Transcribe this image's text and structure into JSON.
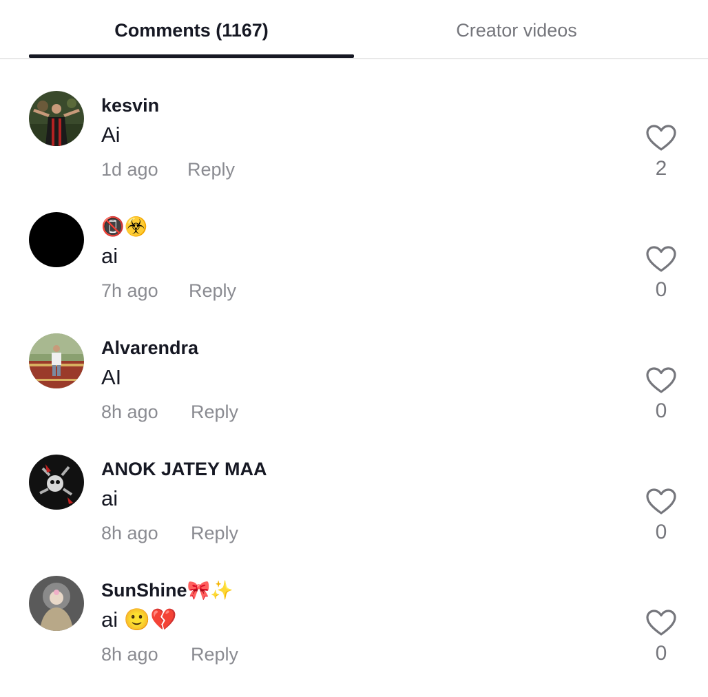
{
  "tabs": {
    "comments_label": "Comments (1167)",
    "creator_label": "Creator videos"
  },
  "actions": {
    "reply_label": "Reply"
  },
  "icons": {
    "like": "heart-outline-icon"
  },
  "comments": [
    {
      "username": "kesvin",
      "text": "Ai",
      "time": "1d ago",
      "likes": "2"
    },
    {
      "username": "📵☣️",
      "text": "ai",
      "time": "7h ago",
      "likes": "0"
    },
    {
      "username": "Alvarendra",
      "text": "AI",
      "time": "8h ago",
      "likes": "0"
    },
    {
      "username": "ANOK JATEY MAA",
      "text": "ai",
      "time": "8h ago",
      "likes": "0"
    },
    {
      "username": "SunShine🎀✨",
      "text": "ai 🙂💔",
      "time": "8h ago",
      "likes": "0"
    }
  ]
}
